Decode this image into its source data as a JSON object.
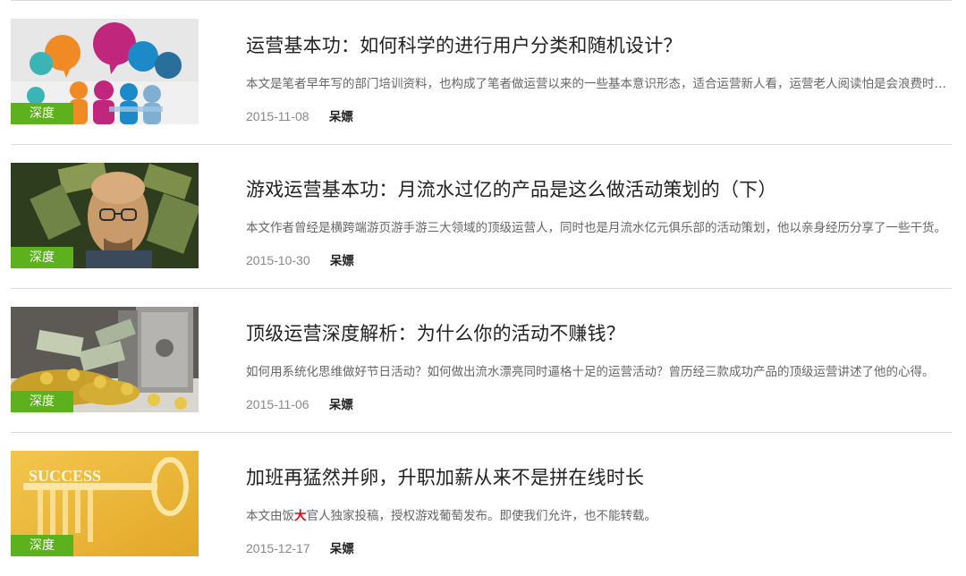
{
  "articles": [
    {
      "title": "运营基本功：如何科学的进行用户分类和随机设计？",
      "summary": "本文是笔者早年写的部门培训资料，也构成了笔者做运营以来的一些基本意识形态，适合运营新人看，运营老人阅读怕是会浪费时间。",
      "date": "2015-11-08",
      "author": "呆嫖",
      "tag": "深度",
      "thumbnail": "speech-bubbles-people-image"
    },
    {
      "title": "游戏运营基本功：月流水过亿的产品是这么做活动策划的（下）",
      "summary": "本文作者曾经是横跨端游页游手游三大领域的顶级运营人，同时也是月流水亿元俱乐部的活动策划，他以亲身经历分享了一些干货。",
      "date": "2015-10-30",
      "author": "呆嫖",
      "tag": "深度",
      "thumbnail": "man-with-money-image"
    },
    {
      "title": "顶级运营深度解析：为什么你的活动不赚钱？",
      "summary": "如何用系统化思维做好节日活动？如何做出流水漂亮同时逼格十足的运营活动？曾历经三款成功产品的顶级运营讲述了他的心得。",
      "date": "2015-11-06",
      "author": "呆嫖",
      "tag": "深度",
      "thumbnail": "safe-with-coins-image"
    },
    {
      "title": "加班再猛然并卵，升职加薪从来不是拼在线时长",
      "summary_parts": [
        "本文由饭",
        "大",
        "官人独家投稿，授权游戏葡萄发布。即使我们允许，也不能转载。"
      ],
      "date": "2015-12-17",
      "author": "呆嫖",
      "tag": "深度",
      "thumbnail": "success-key-image",
      "thumbnail_text": "SUCCESS"
    }
  ],
  "colors": {
    "tag_bg": "#5cb11d",
    "highlight": "#e60012",
    "divider": "#dcdcdc"
  }
}
